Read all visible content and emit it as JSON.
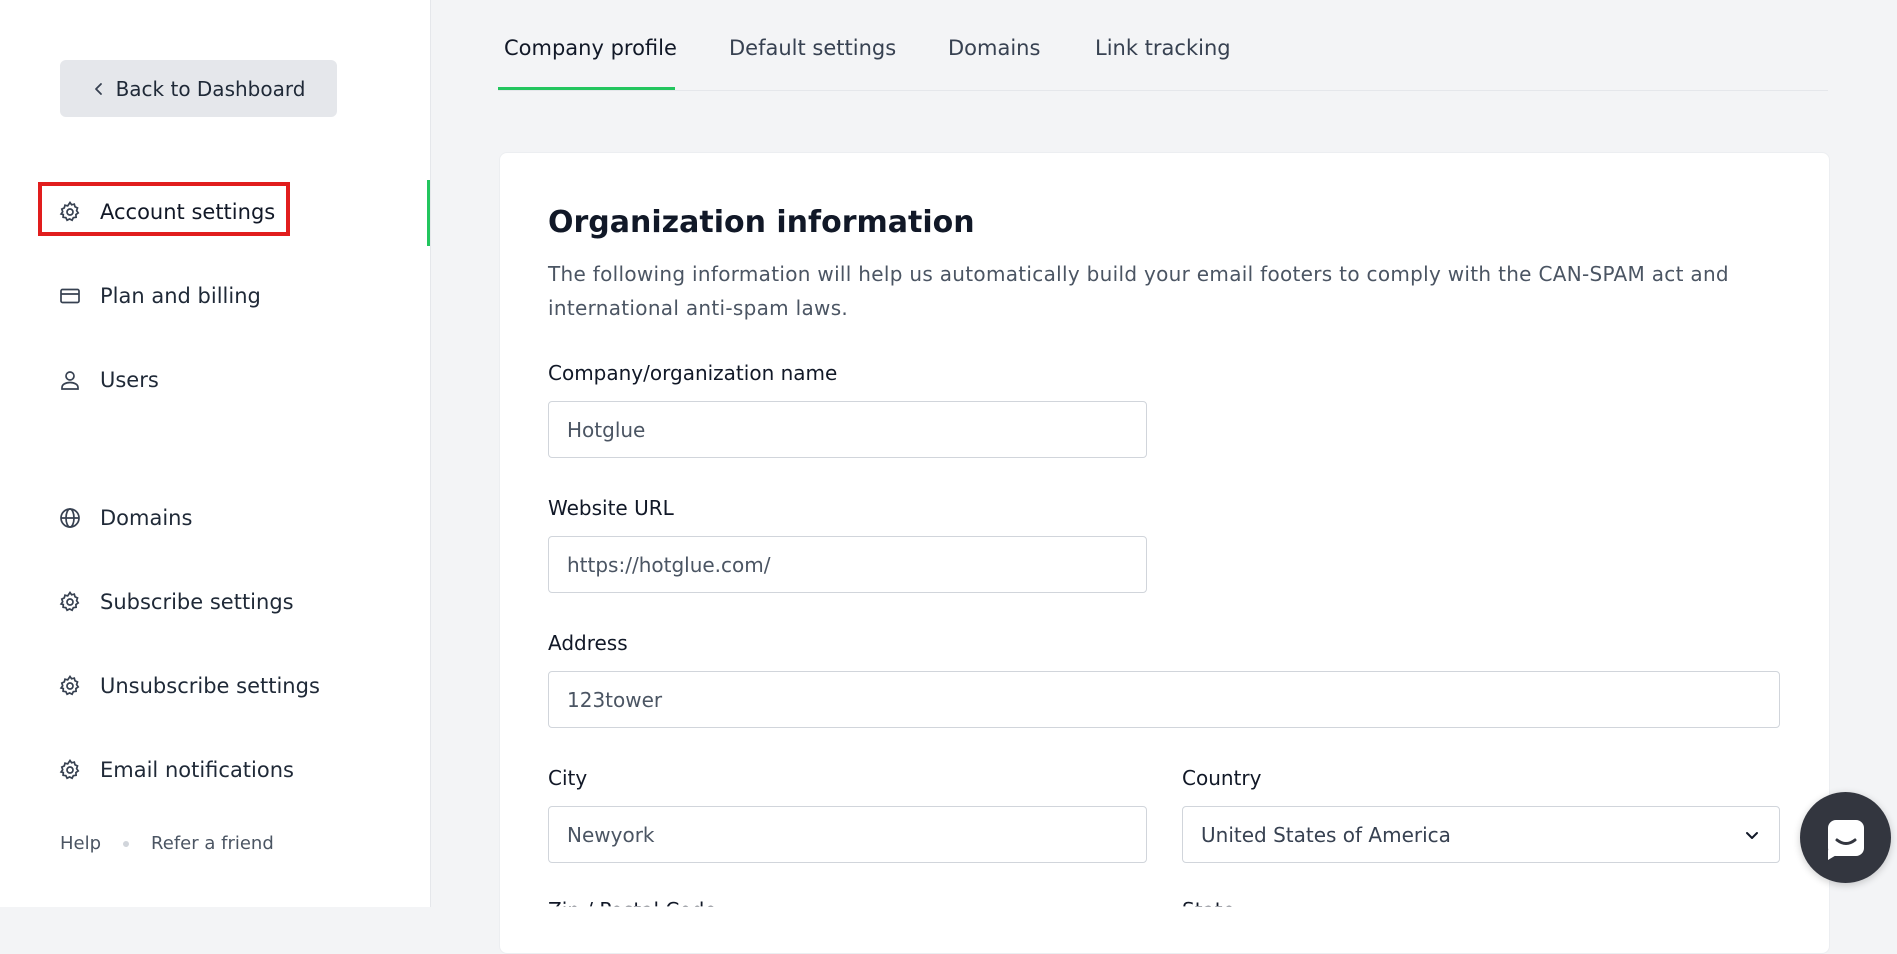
{
  "sidebar": {
    "back_label": "Back to Dashboard",
    "items": [
      {
        "label": "Account settings",
        "icon": "gear-icon",
        "active": true
      },
      {
        "label": "Plan and billing",
        "icon": "credit-card-icon"
      },
      {
        "label": "Users",
        "icon": "user-icon"
      },
      {
        "label": "Domains",
        "icon": "globe-icon"
      },
      {
        "label": "Subscribe settings",
        "icon": "gear-icon"
      },
      {
        "label": "Unsubscribe settings",
        "icon": "gear-icon"
      },
      {
        "label": "Email notifications",
        "icon": "gear-icon"
      }
    ],
    "footer": {
      "help": "Help",
      "refer": "Refer a friend"
    }
  },
  "tabs": [
    {
      "label": "Company profile",
      "active": true
    },
    {
      "label": "Default settings"
    },
    {
      "label": "Domains"
    },
    {
      "label": "Link tracking"
    }
  ],
  "form": {
    "title": "Organization information",
    "description": "The following information will help us automatically build your email footers to comply with the CAN-SPAM act and international anti-spam laws.",
    "company_label": "Company/organization name",
    "company_value": "Hotglue",
    "website_label": "Website URL",
    "website_value": "https://hotglue.com/",
    "address_label": "Address",
    "address_value": "123tower",
    "city_label": "City",
    "city_value": "Newyork",
    "country_label": "Country",
    "country_value": "United States of America",
    "zip_label": "Zip / Postal Code",
    "state_label": "State"
  },
  "colors": {
    "accent": "#22c55e",
    "highlight": "#e11d1d",
    "sidebar_bg": "#ffffff",
    "content_bg": "#f3f4f6"
  }
}
